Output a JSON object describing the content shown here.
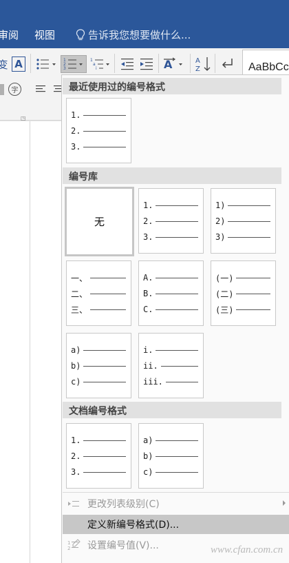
{
  "ribbon_tabs": {
    "review": "审阅",
    "view": "视图",
    "tell_me": "告诉我您想要做什么..."
  },
  "ribbon": {
    "phonetic_char": "变",
    "border_char": "A",
    "enclose_char": "字",
    "style_preview": "AaBbCc"
  },
  "dropdown": {
    "recent_header": "最近使用过的编号格式",
    "library_header": "编号库",
    "document_header": "文档编号格式",
    "none_label": "无",
    "recent": [
      {
        "items": [
          "1.",
          "2.",
          "3."
        ]
      }
    ],
    "library": [
      {
        "items": [
          "1.",
          "2.",
          "3."
        ]
      },
      {
        "items": [
          "1)",
          "2)",
          "3)"
        ]
      },
      {
        "items": [
          "一、",
          "二、",
          "三、"
        ]
      },
      {
        "items": [
          "A.",
          "B.",
          "C."
        ]
      },
      {
        "items": [
          "(一)",
          "(二)",
          "(三)"
        ]
      },
      {
        "items": [
          "a)",
          "b)",
          "c)"
        ]
      },
      {
        "items": [
          "i.",
          "ii.",
          "iii."
        ]
      }
    ],
    "document": [
      {
        "items": [
          "1.",
          "2.",
          "3."
        ]
      },
      {
        "items": [
          "a)",
          "b)",
          "c)"
        ]
      }
    ],
    "menu": {
      "change_level": "更改列表级别(C)",
      "define_new": "定义新编号格式(D)...",
      "set_value": "设置编号值(V)..."
    }
  },
  "watermark": "www.cfan.com.cn",
  "colors": {
    "ribbon_blue": "#2b579a",
    "icon_blue": "#2f5597",
    "hover_gray": "#c7c7c7"
  }
}
